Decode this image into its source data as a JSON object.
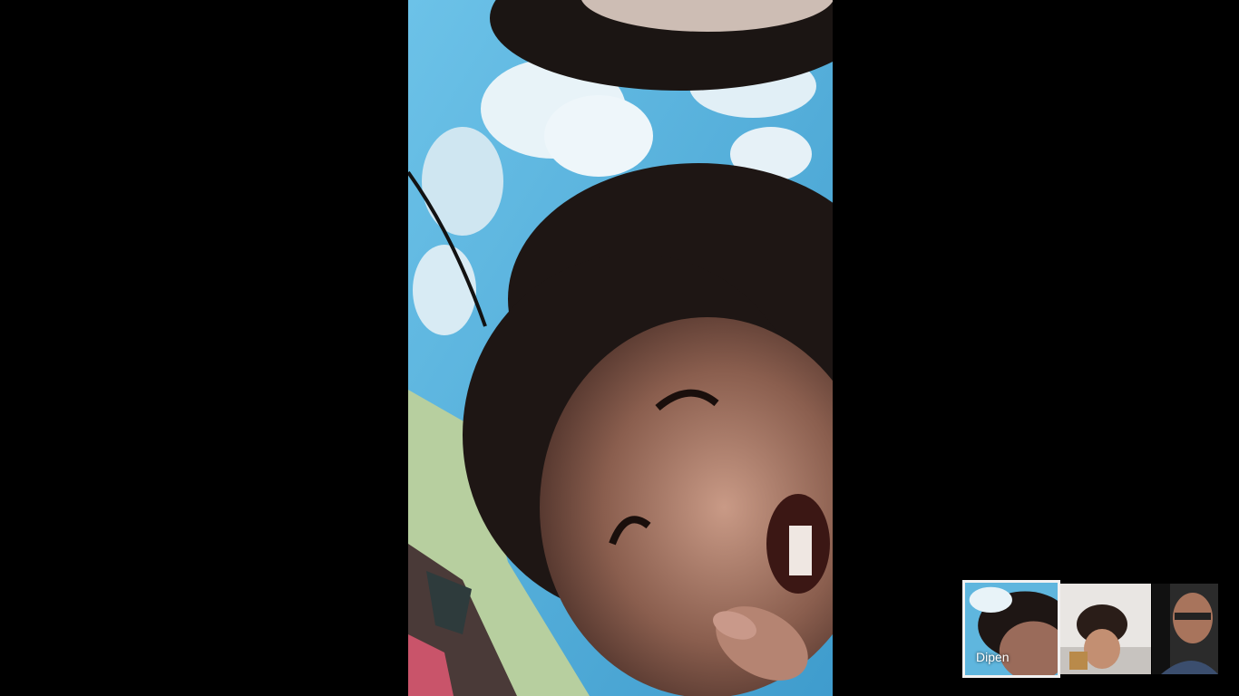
{
  "call": {
    "main_feed": {
      "participant": "Dipen"
    },
    "participants": [
      {
        "name": "Dipen",
        "selected": true
      },
      {
        "name": "",
        "selected": false
      },
      {
        "name": "",
        "selected": false
      }
    ]
  },
  "colors": {
    "background": "#000000",
    "thumbnail_border": "#f2f2f2",
    "label_text": "#ffffff"
  }
}
